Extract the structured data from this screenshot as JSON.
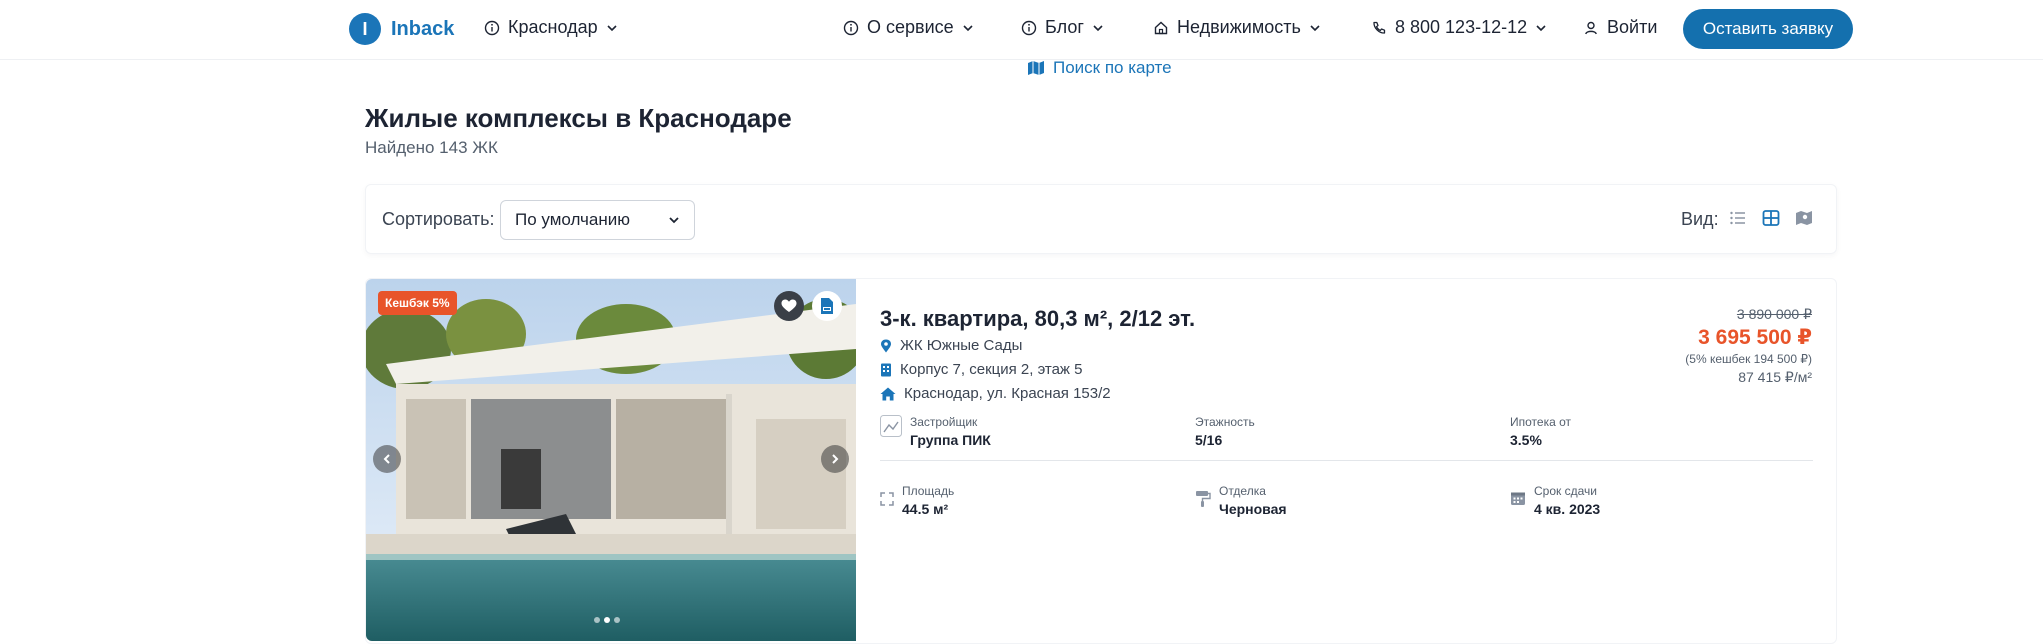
{
  "header": {
    "logo_letter": "I",
    "logo_text": "Inback",
    "city": "Краснодар",
    "about": "О сервисе",
    "blog": "Блог",
    "realty": "Недвижимость",
    "phone": "8 800 123-12-12",
    "login": "Войти",
    "cta": "Оставить заявку"
  },
  "map_link": "Поиск по карте",
  "page": {
    "title": "Жилые комплексы в Краснодаре",
    "found": "Найдено 143 ЖК"
  },
  "sortbar": {
    "sort_label": "Сортировать:",
    "sort_value": "По умолчанию",
    "view_label": "Вид:"
  },
  "listing": {
    "cashback_badge": "Кешбэк 5%",
    "title": "3-к. квартира, 80,3 м², 2/12 эт.",
    "complex": "ЖК Южные Сады",
    "building": "Корпус 7, секция 2, этаж 5",
    "address": "Краснодар, ул. Красная 153/2",
    "price_old": "3 890 000 ₽",
    "price_new": "3 695 500 ₽",
    "price_cashback": "(5% кешбек 194 500 ₽)",
    "price_per_m2": "87 415 ₽/м²",
    "specs": {
      "developer_label": "Застройщик",
      "developer_value": "Группа ПИК",
      "floors_label": "Этажность",
      "floors_value": "5/16",
      "mortgage_label": "Ипотека от",
      "mortgage_value": "3.5%",
      "area_label": "Площадь",
      "area_value": "44.5 м²",
      "finish_label": "Отделка",
      "finish_value": "Черновая",
      "deadline_label": "Срок сдачи",
      "deadline_value": "4 кв. 2023"
    },
    "photo_count": 3,
    "photo_active": 2
  },
  "colors": {
    "brand": "#1b75b8",
    "accent": "#e8542a",
    "cta": "#1470ae"
  },
  "icons": [
    "info-icon",
    "chevron-down-icon",
    "home-icon",
    "phone-icon",
    "user-icon",
    "map-icon",
    "list-view-icon",
    "grid-view-icon",
    "map-view-icon",
    "heart-icon",
    "pdf-icon",
    "location-pin-icon",
    "building-icon",
    "house-icon",
    "area-icon",
    "roller-icon",
    "calendar-icon"
  ]
}
